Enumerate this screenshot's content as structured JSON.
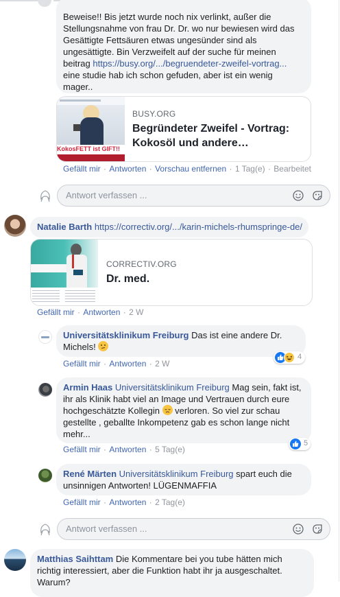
{
  "colors": {
    "link": "#385898",
    "action": "#4267b2",
    "bubble": "#f2f3f5",
    "meta": "#90949c"
  },
  "top_comment": {
    "line1": "Beweise!! Bis jetzt wurde noch nix verlinkt, außer die",
    "line2": "Stellungsnahme von frau Dr. Dr. wo nur bewiesen wird das",
    "line3": "Gesättigte Fettsäuren etwas ungesünder sind als",
    "line4": "ungesättigte. Bin Verzweifelt auf der suche für meinen",
    "line5_prefix": "beitrag ",
    "link": "https://busy.org/.../begruendeter-zweifel-vortrag...",
    "line6": "eine studie hab ich schon gefuden, aber ist ein wenig",
    "line7": "mager..",
    "card": {
      "domain": "BUSY.ORG",
      "title_line1": "Begründeter Zweifel - Vortrag:",
      "title_line2": "Kokosöl und andere…",
      "thumb_caption": "KokosFETT ist GIFT!!"
    },
    "like": "Gefällt mir",
    "reply": "Antworten",
    "remove_preview": "Vorschau entfernen",
    "time": "1 Tag(e)",
    "edited": "Bearbeitet"
  },
  "reply_box_1": {
    "placeholder": "Antwort verfassen ...",
    "icons": [
      "emoji-icon",
      "sticker-icon"
    ]
  },
  "natalie": {
    "name": "Natalie Barth",
    "link": "https://correctiv.org/.../karin-michels-rhumspringe-de/",
    "card": {
      "domain": "CORRECTIV.ORG",
      "title": "Dr. med."
    },
    "like": "Gefällt mir",
    "reply": "Antworten",
    "time": "2 W"
  },
  "uk_reply": {
    "name": "Universitätsklinikum Freiburg",
    "text1": "Das ist eine andere Dr.",
    "text2": "Michels!",
    "reaction_count": "4",
    "like": "Gefällt mir",
    "reply": "Antworten",
    "time": "2 W"
  },
  "armin_reply": {
    "name": "Armin Haas",
    "mention": "Universitätsklinikum Freiburg",
    "text_a": "Mag sein, fakt ist,",
    "text_b": "ihr als Klinik habt viel an Image und Vertrauen durch eure",
    "text_c_pre": "hochgeschätzte Kollegin ",
    "text_c_post": " verloren. So viel zur schau",
    "text_d": "gestellte , geballte Inkompetenz gab es schon lange nicht",
    "text_e": "mehr...",
    "reaction_count": "5",
    "like": "Gefällt mir",
    "reply": "Antworten",
    "time": "5 Tag(e)"
  },
  "rene_reply": {
    "name": "René Märten",
    "mention": "Universitätsklinikum Freiburg",
    "text_a": "spart euch die",
    "text_b": "unsinnigen Antworten! LÜGENMAFFIA",
    "like": "Gefällt mir",
    "reply": "Antworten",
    "time": "2 Tag(e)"
  },
  "reply_box_2": {
    "placeholder": "Antwort verfassen ..."
  },
  "matthias": {
    "name": "Matthias Saihttam",
    "text_a": "Die Kommentare bei you tube hätten mich",
    "text_b": "richtig interessiert, aber die Funktion habt ihr ja ausgeschaltet.",
    "text_c": "Warum?"
  }
}
